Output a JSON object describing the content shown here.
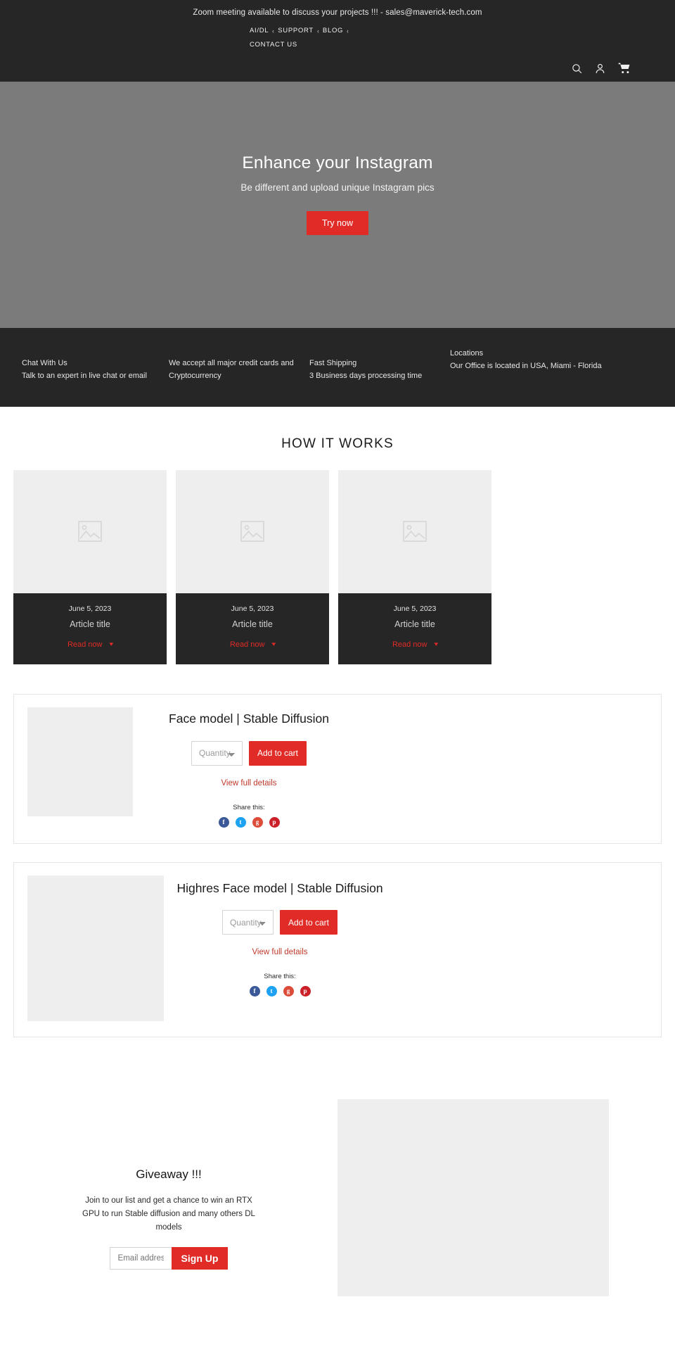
{
  "announcement": {
    "text": "Zoom meeting available to discuss your projects !!! - sales@maverick-tech.com"
  },
  "header": {
    "nav": [
      {
        "label": "AI/DL",
        "caret": "‹"
      },
      {
        "label": "SUPPORT",
        "caret": "‹"
      },
      {
        "label": "BLOG",
        "caret": "‹"
      }
    ],
    "contact_label": "CONTACT US",
    "icons": {
      "search": "search-icon",
      "account": "account-icon",
      "cart": "cart-icon"
    }
  },
  "hero": {
    "title": "Enhance your Instagram",
    "subtitle": "Be different and upload unique Instagram pics",
    "cta_label": "Try now"
  },
  "info_bar": {
    "columns": [
      {
        "head": "Chat With Us",
        "sub": "Talk to an expert in live chat or email"
      },
      {
        "head": "We accept all major credit cards and",
        "sub": "Cryptocurrency"
      },
      {
        "head": "Fast Shipping",
        "sub": "3 Business days processing time"
      },
      {
        "head": "Locations",
        "sub": "Our Office is located in USA, Miami - Florida"
      }
    ]
  },
  "how_it_works": {
    "title": "HOW IT WORKS",
    "cards": [
      {
        "date": "June 5, 2023",
        "title": "Article title",
        "link": "Read now"
      },
      {
        "date": "June 5, 2023",
        "title": "Article title",
        "link": "Read now"
      },
      {
        "date": "June 5, 2023",
        "title": "Article title",
        "link": "Read now"
      }
    ]
  },
  "products": [
    {
      "title": "Face model | Stable Diffusion",
      "quantity_placeholder": "Quantity",
      "add_to_cart_label": "Add to cart",
      "view_details_label": "View full details",
      "share_label": "Share this:",
      "share": [
        {
          "name": "facebook-icon",
          "glyph": "f",
          "color": "#3b5998"
        },
        {
          "name": "twitter-icon",
          "glyph": "t",
          "color": "#1da1f2"
        },
        {
          "name": "googleplus-icon",
          "glyph": "g",
          "color": "#dd4b39"
        },
        {
          "name": "pinterest-icon",
          "glyph": "p",
          "color": "#cb2027"
        }
      ]
    },
    {
      "title": "Highres Face model | Stable Diffusion",
      "quantity_placeholder": "Quantity",
      "add_to_cart_label": "Add to cart",
      "view_details_label": "View full details",
      "share_label": "Share this:",
      "share": [
        {
          "name": "facebook-icon",
          "glyph": "f",
          "color": "#3b5998"
        },
        {
          "name": "twitter-icon",
          "glyph": "t",
          "color": "#1da1f2"
        },
        {
          "name": "googleplus-icon",
          "glyph": "g",
          "color": "#dd4b39"
        },
        {
          "name": "pinterest-icon",
          "glyph": "p",
          "color": "#cb2027"
        }
      ]
    }
  ],
  "giveaway": {
    "title": "Giveaway !!!",
    "text": "Join to our list and get a chance to win an RTX GPU to run Stable diffusion and many others DL models",
    "email_placeholder": "Email address",
    "signup_label": "Sign Up"
  },
  "colors": {
    "accent_red": "#e02b27",
    "dark": "#262626",
    "hero_gray": "#7b7b7b",
    "placeholder_gray": "#eeeeee"
  }
}
